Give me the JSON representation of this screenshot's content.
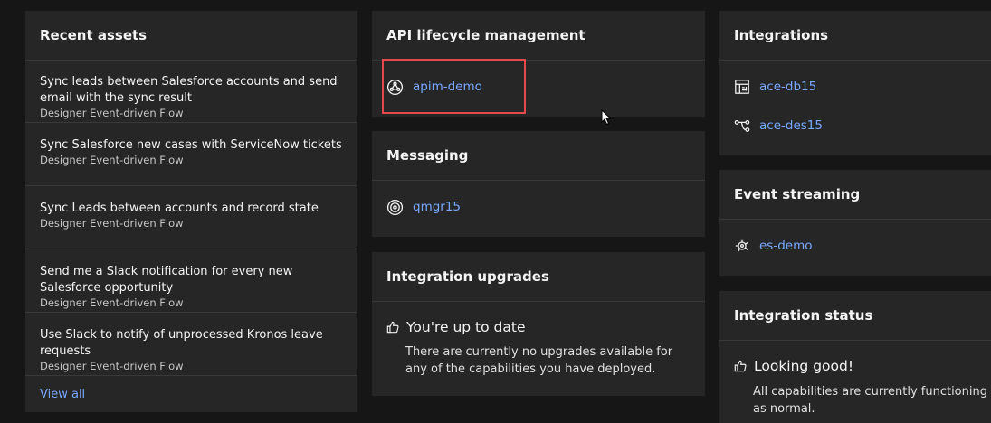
{
  "recent_assets": {
    "title": "Recent assets",
    "items": [
      {
        "title": "Sync leads between Salesforce accounts and send email with the sync result",
        "subtitle": "Designer Event-driven Flow"
      },
      {
        "title": "Sync Salesforce new cases with ServiceNow tickets",
        "subtitle": "Designer Event-driven Flow"
      },
      {
        "title": "Sync Leads between accounts and record state",
        "subtitle": "Designer Event-driven Flow"
      },
      {
        "title": "Send me a Slack notification for every new Salesforce opportunity",
        "subtitle": "Designer Event-driven Flow"
      },
      {
        "title": "Use Slack to notify of unprocessed Kronos leave requests",
        "subtitle": "Designer Event-driven Flow"
      }
    ],
    "view_all": "View all"
  },
  "api_lifecycle": {
    "title": "API lifecycle management",
    "items": [
      {
        "label": "apim-demo",
        "icon": "api-management-icon"
      }
    ]
  },
  "messaging": {
    "title": "Messaging",
    "items": [
      {
        "label": "qmgr15",
        "icon": "queue-manager-icon"
      }
    ]
  },
  "integration_upgrades": {
    "title": "Integration upgrades",
    "status_title": "You're up to date",
    "status_body": "There are currently no upgrades available for any of the capabilities you have deployed."
  },
  "integrations": {
    "title": "Integrations",
    "items": [
      {
        "label": "ace-db15",
        "icon": "dashboard-icon"
      },
      {
        "label": "ace-des15",
        "icon": "flow-icon"
      }
    ]
  },
  "event_streaming": {
    "title": "Event streaming",
    "items": [
      {
        "label": "es-demo",
        "icon": "event-streams-icon"
      }
    ]
  },
  "integration_status": {
    "title": "Integration status",
    "status_title": "Looking good!",
    "status_body": "All capabilities are currently functioning as normal."
  },
  "colors": {
    "background": "#161616",
    "tile": "#262626",
    "link": "#78a9ff",
    "highlight": "#e5484d"
  }
}
